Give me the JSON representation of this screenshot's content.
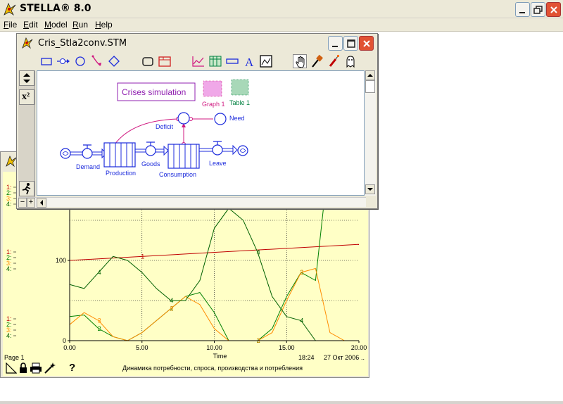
{
  "app": {
    "title": "STELLA® 8.0"
  },
  "menu": [
    {
      "key": "F",
      "rest": "ile"
    },
    {
      "key": "E",
      "rest": "dit"
    },
    {
      "key": "M",
      "rest": "odel"
    },
    {
      "key": "R",
      "rest": "un"
    },
    {
      "key": "H",
      "rest": "elp"
    }
  ],
  "model_window": {
    "title": "Cris_Stla2conv.STM",
    "sidebar_x2": "x²",
    "diagram": {
      "text_box": "Crises simulation",
      "graph_pad": "Graph 1",
      "table_pad": "Table 1",
      "converters": [
        "Deficit",
        "Need"
      ],
      "flows": [
        "Demand",
        "Goods",
        "Leave"
      ],
      "stocks": [
        "Production",
        "Consumption"
      ]
    },
    "hscroll_minus": "−",
    "hscroll_plus": "+"
  },
  "graph_window": {
    "page_label": "Page 1",
    "footer_time": "18:24",
    "footer_date": "27 Окт 2006",
    "footer_dots": "..",
    "footer_title": "Динамика потребности, спроса, производства и потребления",
    "help_glyph": "?",
    "colors": {
      "s1": "#c00000",
      "s2": "#008000",
      "s3": "#ff8c00",
      "s4": "#006000",
      "bg": "#ffffc6"
    }
  },
  "chart_data": {
    "type": "line",
    "xlabel": "Time",
    "x_ticks": [
      "0.00",
      "5.00",
      "10.00",
      "15.00",
      "20.00"
    ],
    "y_ticks": [
      "0",
      "100"
    ],
    "xlim": [
      0,
      20
    ],
    "ylim": [
      0,
      200
    ],
    "grid": true,
    "series_legend_numbers": [
      "1:",
      "2:",
      "3:",
      "4:"
    ],
    "series": [
      {
        "id": "1",
        "x": [
          0,
          20
        ],
        "values": [
          100,
          120
        ]
      },
      {
        "id": "2",
        "x": [
          0,
          1,
          2,
          3,
          4,
          5,
          6,
          7,
          8,
          9,
          10,
          11,
          12,
          13,
          14,
          15,
          16,
          17,
          18,
          19,
          20
        ],
        "values": [
          30,
          32,
          15,
          5,
          0,
          10,
          25,
          40,
          55,
          60,
          35,
          0,
          0,
          0,
          15,
          55,
          85,
          75,
          240,
          300,
          300
        ]
      },
      {
        "id": "3",
        "x": [
          0,
          1,
          2,
          3,
          4,
          5,
          6,
          7,
          8,
          9,
          10,
          11,
          12,
          13,
          14,
          15,
          16,
          17,
          18,
          19,
          20
        ],
        "values": [
          20,
          35,
          25,
          5,
          0,
          10,
          25,
          40,
          55,
          45,
          15,
          0,
          0,
          0,
          10,
          50,
          85,
          90,
          10,
          0,
          0
        ]
      },
      {
        "id": "4",
        "x": [
          0,
          1,
          2,
          3,
          4,
          5,
          6,
          7,
          8,
          9,
          10,
          11,
          12,
          13,
          14,
          15,
          16,
          17,
          18,
          19,
          20
        ],
        "values": [
          70,
          65,
          85,
          105,
          100,
          85,
          65,
          50,
          50,
          75,
          140,
          165,
          150,
          110,
          55,
          30,
          25,
          0,
          0,
          0,
          0
        ]
      }
    ]
  }
}
